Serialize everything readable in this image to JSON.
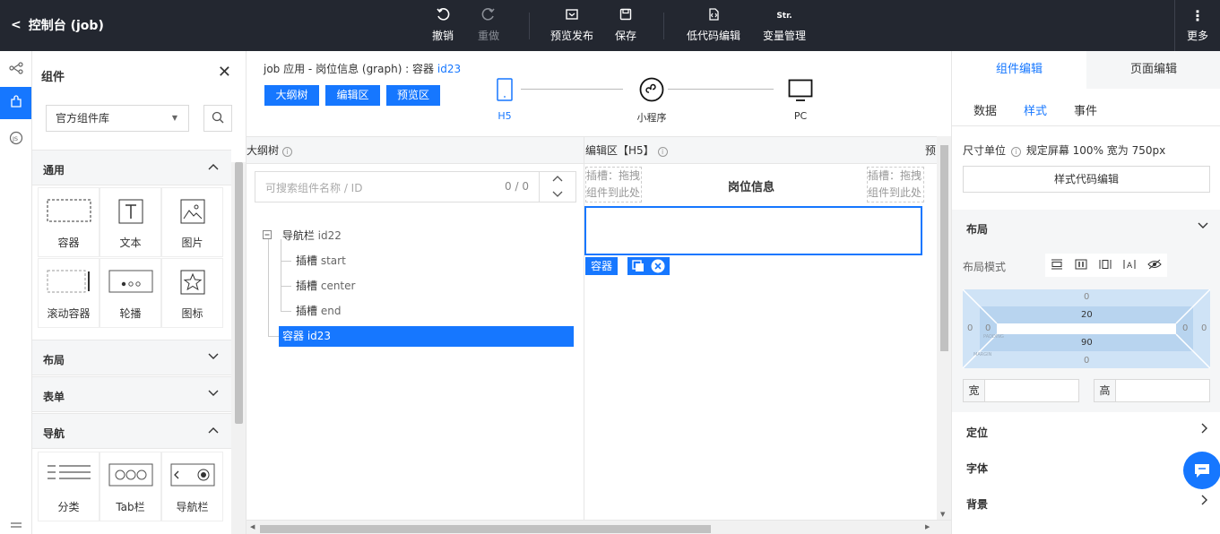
{
  "topbar": {
    "back_label": "控制台 (job)",
    "actions": [
      {
        "label": "撤销",
        "icon": "undo-icon",
        "disabled": false
      },
      {
        "label": "重做",
        "icon": "redo-icon",
        "disabled": true
      },
      {
        "label": "预览发布",
        "icon": "preview-publish-icon",
        "disabled": false
      },
      {
        "label": "保存",
        "icon": "save-icon",
        "disabled": false
      },
      {
        "label": "低代码编辑",
        "icon": "lowcode-edit-icon",
        "disabled": false
      },
      {
        "label": "变量管理",
        "icon": "variable-icon",
        "disabled": false
      },
      {
        "label": "更多",
        "icon": "more-vertical-icon",
        "disabled": false
      }
    ],
    "variable_icon_text": "Str."
  },
  "components_panel": {
    "title": "组件",
    "library_select": "官方组件库",
    "categories": [
      {
        "name": "通用",
        "expanded": true,
        "items": [
          {
            "label": "容器",
            "icon": "container-icon"
          },
          {
            "label": "文本",
            "icon": "text-icon"
          },
          {
            "label": "图片",
            "icon": "image-icon"
          },
          {
            "label": "滚动容器",
            "icon": "scroll-container-icon"
          },
          {
            "label": "轮播",
            "icon": "carousel-icon"
          },
          {
            "label": "图标",
            "icon": "star-icon"
          }
        ]
      },
      {
        "name": "布局",
        "expanded": false
      },
      {
        "name": "表单",
        "expanded": false
      },
      {
        "name": "导航",
        "expanded": true,
        "items": [
          {
            "label": "分类",
            "icon": "category-icon"
          },
          {
            "label": "Tab栏",
            "icon": "tabbar-icon"
          },
          {
            "label": "导航栏",
            "icon": "navbar-icon"
          }
        ]
      }
    ]
  },
  "center": {
    "breadcrumb": "job 应用 - 岗位信息 (graph) : 容器",
    "breadcrumb_id": "id23",
    "view_buttons": [
      "大纲树",
      "编辑区",
      "预览区"
    ],
    "devices": [
      {
        "label": "H5",
        "icon": "mobile-icon",
        "active": true
      },
      {
        "label": "小程序",
        "icon": "miniprogram-icon",
        "active": false
      },
      {
        "label": "PC",
        "icon": "monitor-icon",
        "active": false
      }
    ],
    "outline": {
      "header": "大纲树",
      "search_placeholder": "可搜索组件名称 / ID",
      "search_count": "0 / 0",
      "nodes": [
        {
          "name": "导航栏",
          "id": "id22"
        },
        {
          "name": "插槽",
          "id": "start"
        },
        {
          "name": "插槽",
          "id": "center"
        },
        {
          "name": "插槽",
          "id": "end"
        },
        {
          "name": "容器",
          "id": "id23",
          "selected": true
        }
      ]
    },
    "editor": {
      "header": "编辑区【H5】",
      "next_header": "预",
      "slot_left": [
        "插槽：拖拽",
        "组件到此处"
      ],
      "slot_right": [
        "插槽：拖拽",
        "组件到此处"
      ],
      "page_title": "岗位信息",
      "selected_tag": "容器"
    }
  },
  "right_panel": {
    "tabs": [
      "组件编辑",
      "页面编辑"
    ],
    "subtabs": [
      "数据",
      "样式",
      "事件"
    ],
    "unit_label": "尺寸单位",
    "unit_text": "规定屏幕 100% 宽为 750px",
    "style_code_button": "样式代码编辑",
    "sections": {
      "layout": "布局",
      "layout_mode": "布局模式",
      "position": "定位",
      "font": "字体",
      "background": "背景"
    },
    "box_model": {
      "margin_top": "0",
      "margin_left": "0",
      "margin_right": "0",
      "margin_bottom": "0",
      "padding_top": "20",
      "padding_left": "0",
      "padding_right": "0",
      "padding_bottom": "90",
      "padding_caption": "PADDING",
      "margin_caption": "MARGIN"
    },
    "width_label": "宽",
    "height_label": "高",
    "width_value": "",
    "height_value": ""
  },
  "colors": {
    "primary": "#1677ff",
    "topbar": "#232730"
  }
}
